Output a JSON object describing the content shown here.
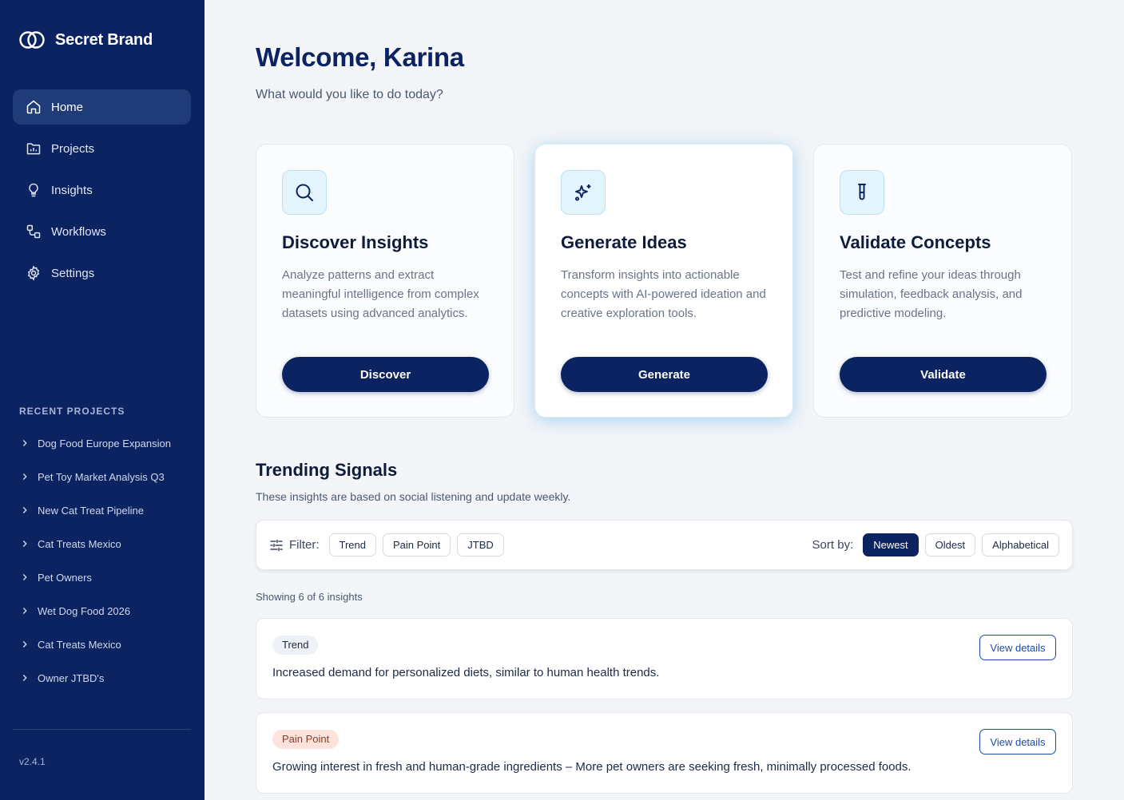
{
  "brand": {
    "name": "Secret Brand"
  },
  "nav": {
    "items": [
      {
        "label": "Home",
        "active": true
      },
      {
        "label": "Projects"
      },
      {
        "label": "Insights"
      },
      {
        "label": "Workflows"
      },
      {
        "label": "Settings"
      }
    ]
  },
  "recent": {
    "title": "RECENT PROJECTS",
    "items": [
      "Dog Food Europe Expansion",
      "Pet Toy Market Analysis Q3",
      "New Cat Treat Pipeline",
      "Cat Treats Mexico",
      "Pet Owners",
      "Wet Dog Food 2026",
      "Cat Treats Mexico",
      "Owner JTBD's"
    ]
  },
  "version": "v2.4.1",
  "header": {
    "welcome": "Welcome, Karina",
    "subtitle": "What would you like to do today?"
  },
  "cards": [
    {
      "icon": "search-icon",
      "title": "Discover Insights",
      "desc": "Analyze patterns and extract meaningful intelligence from complex datasets using advanced analytics.",
      "button": "Discover"
    },
    {
      "icon": "sparkles-icon",
      "title": "Generate Ideas",
      "desc": "Transform insights into actionable concepts with AI-powered ideation and creative exploration tools.",
      "button": "Generate"
    },
    {
      "icon": "test-tube-icon",
      "title": "Validate Concepts",
      "desc": "Test and refine your ideas through simulation, feedback analysis, and predictive modeling.",
      "button": "Validate"
    }
  ],
  "trending": {
    "title": "Trending Signals",
    "subtitle": "These insights are based on social listening and update weekly."
  },
  "filter": {
    "label": "Filter:",
    "options": [
      "Trend",
      "Pain Point",
      "JTBD"
    ],
    "sort_label": "Sort by:",
    "sort_options": [
      "Newest",
      "Oldest",
      "Alphabetical"
    ],
    "sort_selected": "Newest"
  },
  "showing": "Showing 6 of 6 insights",
  "insights": [
    {
      "tag": "Trend",
      "text": "Increased demand for personalized diets, similar to human health trends.",
      "button": "View details"
    },
    {
      "tag": "Pain Point",
      "text": "Growing interest in fresh and human-grade ingredients – More pet owners are seeking fresh, minimally processed foods.",
      "button": "View details"
    }
  ],
  "colors": {
    "sidebar": "#0b2360",
    "primary": "#0b2360",
    "accent": "#1d4ba8",
    "pain_tag": "#fde3dc"
  }
}
